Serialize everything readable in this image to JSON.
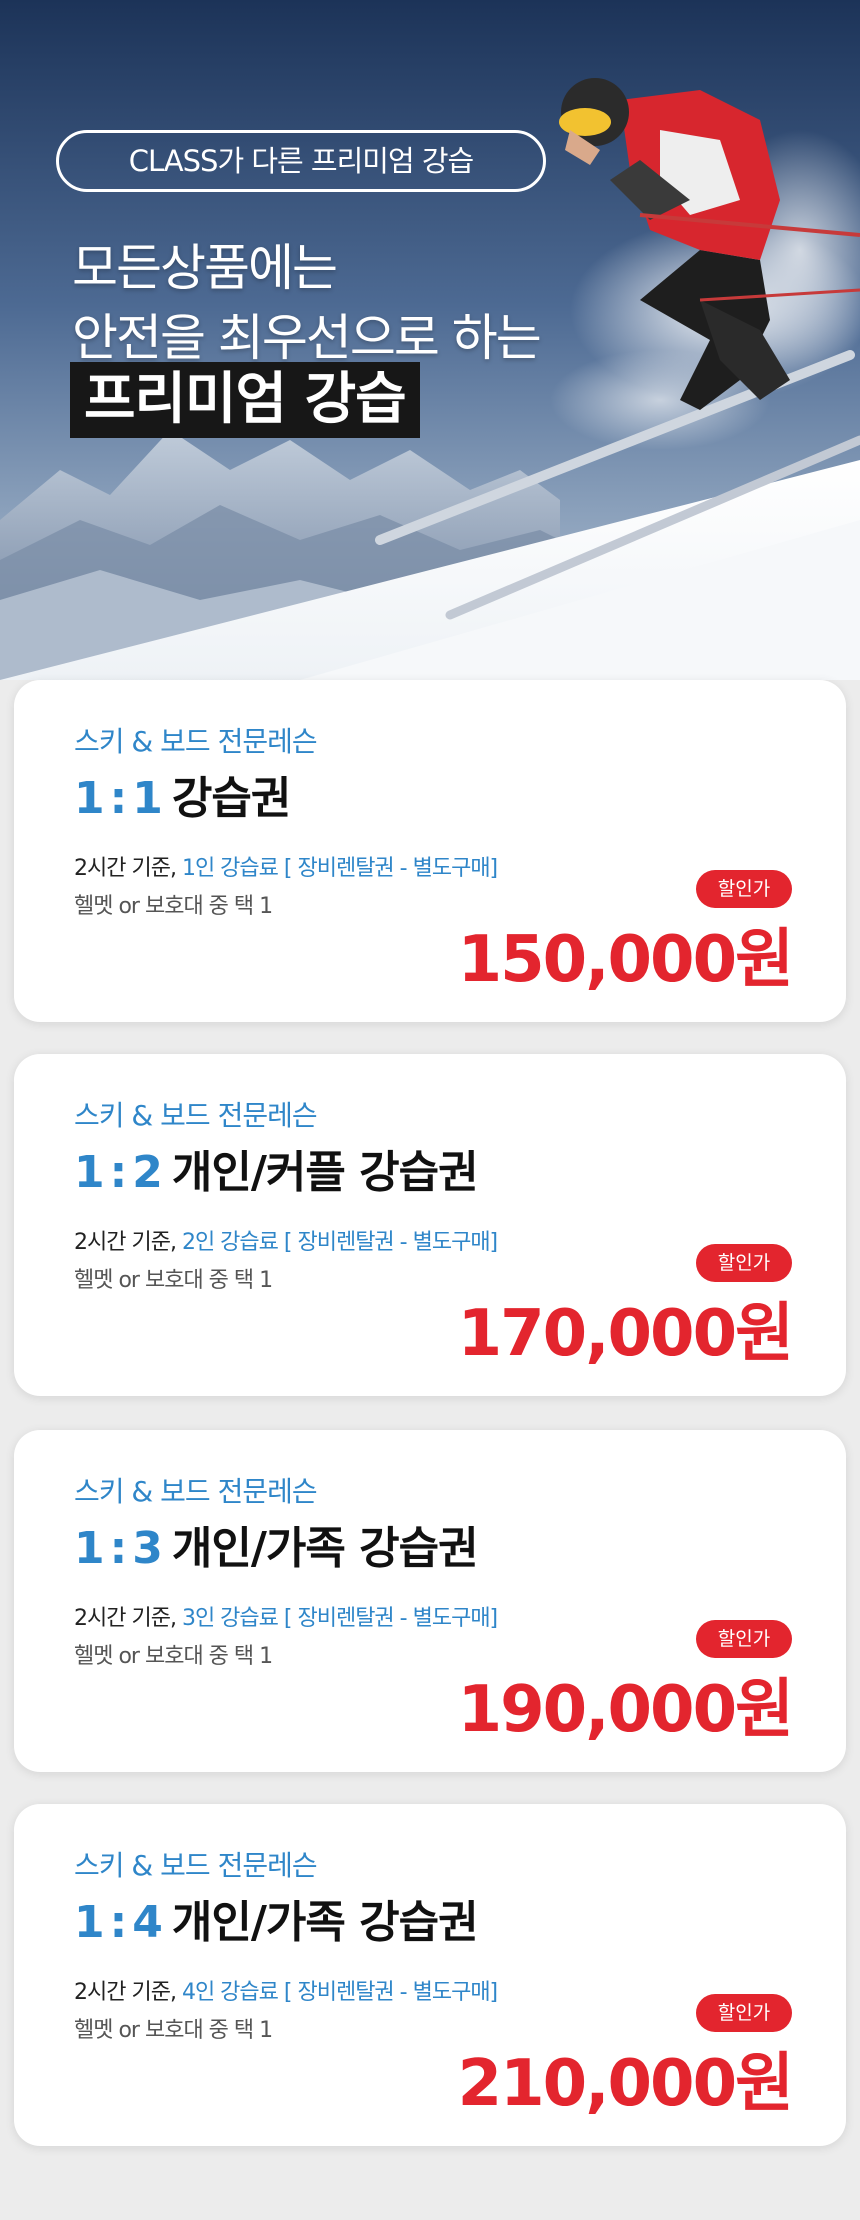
{
  "hero": {
    "pill_text": "CLASS가 다른 프리미엄 강습",
    "line1": "모든상품에는",
    "line2": "안전을 최우선으로 하는",
    "highlight": "프리미엄 강습"
  },
  "colors": {
    "accent_blue": "#2f86c9",
    "price_red": "#e3252e",
    "highlight_bg": "#171717"
  },
  "cards": [
    {
      "category": "스키 & 보드 전문레슨",
      "ratio_left": "1",
      "ratio_colon": ":",
      "ratio_right": "1",
      "name": "강습권",
      "desc_prefix": "2시간 기준,",
      "desc_highlight": "1인 강습료 [ 장비렌탈권 - 별도구매]",
      "desc_line2": "헬멧 or 보호대 중 택 1",
      "badge": "할인가",
      "price": "150,000원"
    },
    {
      "category": "스키 & 보드 전문레슨",
      "ratio_left": "1",
      "ratio_colon": ":",
      "ratio_right": "2",
      "name": "개인/커플 강습권",
      "desc_prefix": "2시간 기준,",
      "desc_highlight": "2인 강습료 [ 장비렌탈권 - 별도구매]",
      "desc_line2": "헬멧 or 보호대 중 택 1",
      "badge": "할인가",
      "price": "170,000원"
    },
    {
      "category": "스키 & 보드 전문레슨",
      "ratio_left": "1",
      "ratio_colon": ":",
      "ratio_right": "3",
      "name": "개인/가족 강습권",
      "desc_prefix": "2시간 기준,",
      "desc_highlight": "3인 강습료 [ 장비렌탈권 - 별도구매]",
      "desc_line2": "헬멧 or 보호대 중 택 1",
      "badge": "할인가",
      "price": "190,000원"
    },
    {
      "category": "스키 & 보드 전문레슨",
      "ratio_left": "1",
      "ratio_colon": ":",
      "ratio_right": "4",
      "name": "개인/가족 강습권",
      "desc_prefix": "2시간 기준,",
      "desc_highlight": "4인 강습료 [ 장비렌탈권 - 별도구매]",
      "desc_line2": "헬멧 or 보호대 중 택 1",
      "badge": "할인가",
      "price": "210,000원"
    }
  ]
}
